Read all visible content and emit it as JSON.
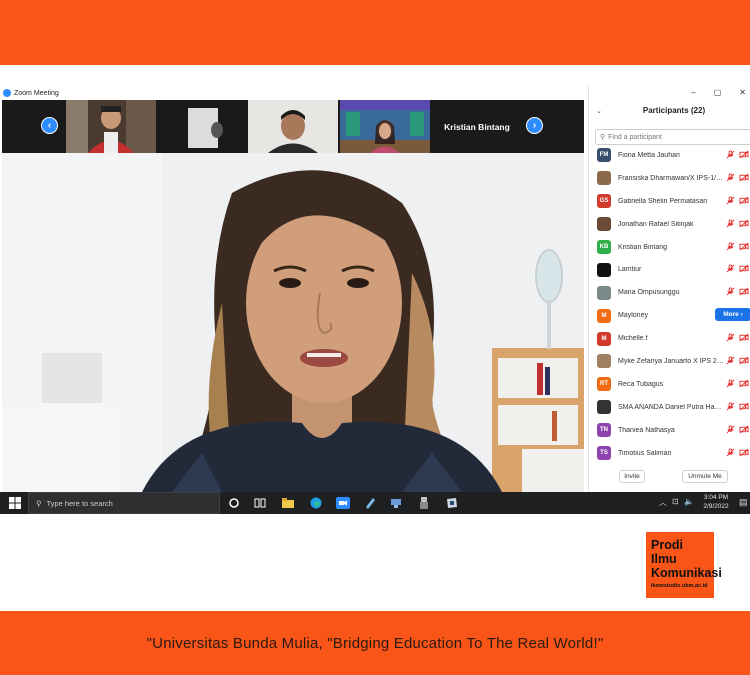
{
  "window": {
    "title": "Zoom Meeting"
  },
  "strip": {
    "featured_name": "Kristian Bintang"
  },
  "panel": {
    "title": "Participants (22)",
    "search_placeholder": "Find a participant",
    "participants": [
      {
        "initials": "FM",
        "name": "Fiona Metta Jauhari",
        "color": "#3a4f6b"
      },
      {
        "initials": "",
        "name": "Fransiska Dharmawan/X IPS-1/…",
        "color": "#8a6a4a"
      },
      {
        "initials": "GS",
        "name": "Gabriella Shelin Permatasari",
        "color": "#d13b2e"
      },
      {
        "initials": "",
        "name": "Jonathan Rafael Sitinjak",
        "color": "#6b4a3a"
      },
      {
        "initials": "KB",
        "name": "Kristian Bintang",
        "color": "#2fae4a"
      },
      {
        "initials": "",
        "name": "Lamtiur",
        "color": "#111111"
      },
      {
        "initials": "",
        "name": "Maria Ompusunggu",
        "color": "#7a8a8a"
      },
      {
        "initials": "M",
        "name": "Mayloney",
        "color": "#f26b12"
      },
      {
        "initials": "M",
        "name": "Michelle.f",
        "color": "#d13b2e"
      },
      {
        "initials": "",
        "name": "Myke Zefanya Januarto X IPS 2 …",
        "color": "#a08060"
      },
      {
        "initials": "RT",
        "name": "Reca Tubagus",
        "color": "#f26b12"
      },
      {
        "initials": "",
        "name": "SMA ANANDA Daniel Putra Ha…",
        "color": "#333333"
      },
      {
        "initials": "TN",
        "name": "Thaniea Nathasya",
        "color": "#8e44ad"
      },
      {
        "initials": "TS",
        "name": "Timotius Saliman",
        "color": "#8e44ad"
      }
    ],
    "more_label": "More ›",
    "invite_label": "Invite",
    "unmute_label": "Unmute Me"
  },
  "taskbar": {
    "search_placeholder": "Type here to search",
    "time": "3:04 PM",
    "date": "2/9/2022"
  },
  "brand": {
    "line1": "Prodi",
    "line2": "Ilmu",
    "line3": "Komunikasi",
    "site": "ikomstudio.ubm.ac.id"
  },
  "slogan": "\"Universitas Bunda Mulia, \"Bridging Education To The Real World!\"",
  "colors": {
    "accent": "#fa5518",
    "zoom_blue": "#2d8cff",
    "mute_red": "#e02828"
  }
}
